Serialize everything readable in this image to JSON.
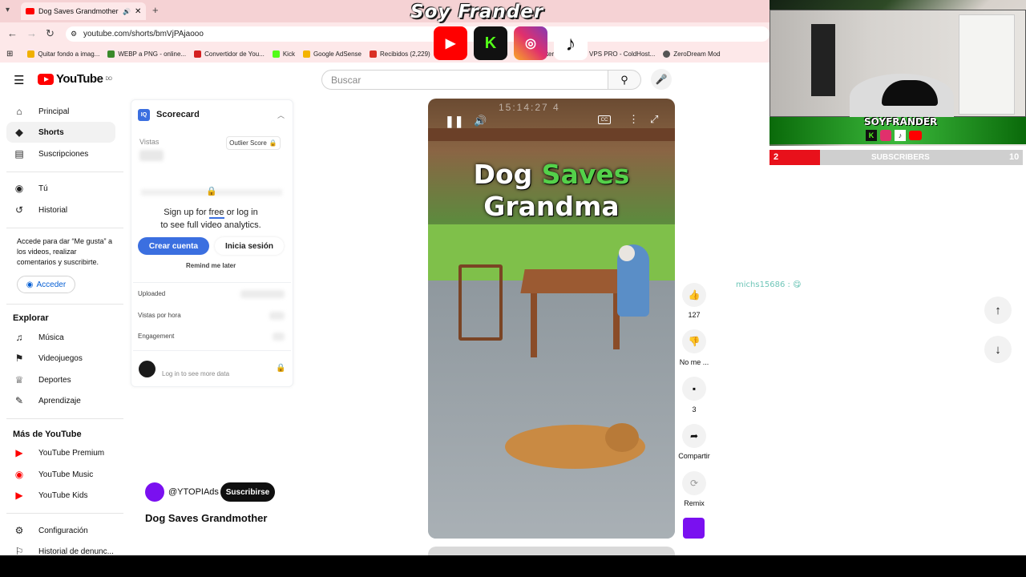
{
  "browser": {
    "tab_title": "Dog Saves Grandmother - Y",
    "new_tab": "+",
    "url": "youtube.com/shorts/bmVjPAjaooo",
    "bookmarks": [
      {
        "label": "Quitar fondo a imag...",
        "color": "#f0b000"
      },
      {
        "label": "WEBP a PNG - online...",
        "color": "#3a8a2a"
      },
      {
        "label": "Convertidor de You...",
        "color": "#d42020"
      },
      {
        "label": "Kick",
        "color": "#53fc18"
      },
      {
        "label": "Google AdSense",
        "color": "#f4b400"
      },
      {
        "label": "Recibidos (2,229)",
        "color": "#d93025"
      },
      {
        "label": "Masterclas...",
        "color": "#333333"
      },
      {
        "label": "VPS PRO - ColdHost...",
        "color": "#444444"
      },
      {
        "label": "ZeroDream Mod",
        "color": "#555555"
      }
    ]
  },
  "header": {
    "logo_text": "YouTube",
    "logo_suffix": "DO",
    "search_placeholder": "Buscar"
  },
  "sidebar": {
    "main": [
      {
        "label": "Principal",
        "icon": "home-icon",
        "glyph": "⌂"
      },
      {
        "label": "Shorts",
        "icon": "shorts-icon",
        "glyph": "◆"
      },
      {
        "label": "Suscripciones",
        "icon": "subscriptions-icon",
        "glyph": "▤"
      }
    ],
    "you": [
      {
        "label": "Tú",
        "icon": "user-icon",
        "glyph": "◉"
      },
      {
        "label": "Historial",
        "icon": "history-icon",
        "glyph": "↺"
      }
    ],
    "signin_text": "Accede para dar “Me gusta” a los videos, realizar comentarios y suscribirte.",
    "signin_button": "Acceder",
    "explore_heading": "Explorar",
    "explore": [
      {
        "label": "Música",
        "icon": "music-icon",
        "glyph": "♫"
      },
      {
        "label": "Videojuegos",
        "icon": "gaming-icon",
        "glyph": "⚑"
      },
      {
        "label": "Deportes",
        "icon": "trophy-icon",
        "glyph": "♕"
      },
      {
        "label": "Aprendizaje",
        "icon": "learning-icon",
        "glyph": "✎"
      }
    ],
    "more_heading": "Más de YouTube",
    "more": [
      {
        "label": "YouTube Premium"
      },
      {
        "label": "YouTube Music"
      },
      {
        "label": "YouTube Kids"
      }
    ],
    "bottom": [
      {
        "label": "Configuración",
        "icon": "gear-icon",
        "glyph": "⚙"
      },
      {
        "label": "Historial de denunc...",
        "icon": "flag-icon",
        "glyph": "⚐"
      }
    ]
  },
  "scorecard": {
    "title": "Scorecard",
    "logo": "IQ",
    "views_label": "Vistas",
    "outlier_label": "Outlier Score",
    "signup_line1_pre": "Sign up for ",
    "signup_free": "free",
    "signup_line1_post": " or log in",
    "signup_line2": "to see full video analytics.",
    "create_button": "Crear cuenta",
    "login_button": "Inicia sesión",
    "remind": "Remind me later",
    "rows": [
      {
        "label": "Uploaded"
      },
      {
        "label": "Vistas por hora"
      },
      {
        "label": "Engagement"
      }
    ],
    "more_data": "Log in to see more data"
  },
  "video": {
    "overlay_line1_a": "Dog ",
    "overlay_line1_b": "Saves",
    "overlay_line2": "Grandma",
    "timestamp": "15:14:27 4",
    "title": "Dog Saves Grandmother",
    "channel": "@YTOPIAds",
    "subscribe": "Suscribirse"
  },
  "actions": {
    "likes": "127",
    "dislike_label": "No me ...",
    "comments": "3",
    "share_label": "Compartir",
    "remix_label": "Remix"
  },
  "stream": {
    "brand": "Soy Frander",
    "webcam_name": "SOYFRANDER",
    "sub_current": "2",
    "sub_label": "SUBSCRIBERS",
    "sub_goal": "10",
    "sub_progress": 0.2,
    "chat_user": "michs15686 :"
  }
}
